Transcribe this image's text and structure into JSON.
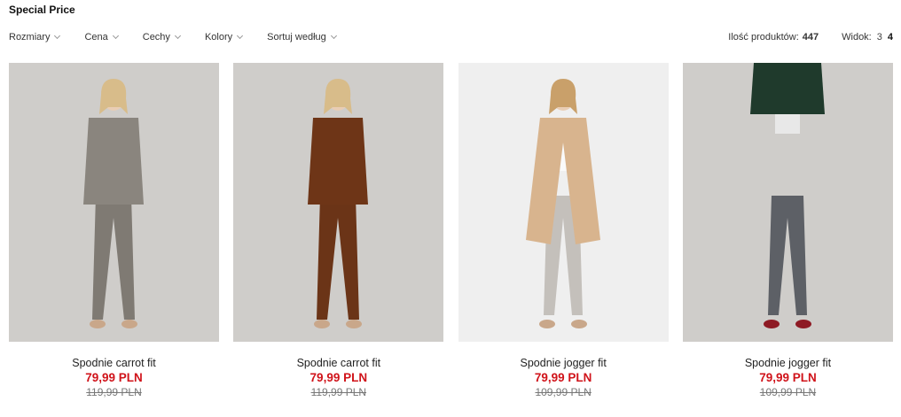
{
  "page": {
    "title": "Special Price"
  },
  "filters": [
    {
      "label": "Rozmiary"
    },
    {
      "label": "Cena"
    },
    {
      "label": "Cechy"
    },
    {
      "label": "Kolory"
    },
    {
      "label": "Sortuj według"
    }
  ],
  "meta": {
    "count_label": "Ilość produktów:",
    "count_value": "447",
    "view_label": "Widok:",
    "view_options": [
      "3",
      "4"
    ],
    "active_view": "4"
  },
  "products": [
    {
      "name": "Spodnie carrot fit",
      "price": "79,99 PLN",
      "old_price": "119,99 PLN",
      "colors": {
        "bg": "#cfcdca",
        "jacket": "#8a857e",
        "top": "#9a948c",
        "pants": "#7f7a73",
        "hair": "#d8bc8a",
        "shoes": "#c9a78a"
      }
    },
    {
      "name": "Spodnie carrot fit",
      "price": "79,99 PLN",
      "old_price": "119,99 PLN",
      "colors": {
        "bg": "#cfcdca",
        "jacket": "#6e3517",
        "top": "#e6cdb3",
        "pants": "#6b3417",
        "hair": "#d8bc8a",
        "shoes": "#c9a78a"
      }
    },
    {
      "name": "Spodnie jogger fit",
      "price": "79,99 PLN",
      "old_price": "109,99 PLN",
      "colors": {
        "bg": "#efefef",
        "jacket": "#d8b48e",
        "top": "#fafafa",
        "pants": "#c4c0bb",
        "hair": "#c9a06a",
        "shoes": "#c9a78a"
      }
    },
    {
      "name": "Spodnie jogger fit",
      "price": "79,99 PLN",
      "old_price": "109,99 PLN",
      "colors": {
        "bg": "#cfcdca",
        "jacket": "#1f3a2c",
        "top": "#e8e8e8",
        "pants": "#5d6066",
        "hair": "#5a3d2a",
        "shoes": "#8e1a24"
      }
    }
  ]
}
